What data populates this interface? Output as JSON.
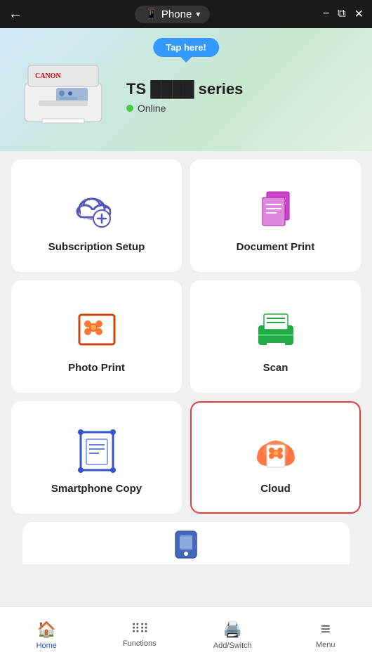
{
  "titleBar": {
    "backLabel": "←",
    "deviceIcon": "📱",
    "title": "Phone",
    "chevron": "▾",
    "minimizeBtn": "−",
    "restoreBtn": "⧉",
    "closeBtn": "✕"
  },
  "hero": {
    "tapBubble": "Tap here!",
    "printerModel": "TS ████ series",
    "statusText": "Online"
  },
  "grid": {
    "items": [
      {
        "id": "subscription-setup",
        "label": "Subscription Setup",
        "selected": false
      },
      {
        "id": "document-print",
        "label": "Document Print",
        "selected": false
      },
      {
        "id": "photo-print",
        "label": "Photo Print",
        "selected": false
      },
      {
        "id": "scan",
        "label": "Scan",
        "selected": false
      },
      {
        "id": "smartphone-copy",
        "label": "Smartphone Copy",
        "selected": false
      },
      {
        "id": "cloud",
        "label": "Cloud",
        "selected": true
      }
    ]
  },
  "bottomNav": {
    "items": [
      {
        "id": "home",
        "label": "Home",
        "icon": "🏠",
        "active": true
      },
      {
        "id": "functions",
        "label": "Functions",
        "icon": "⠿",
        "active": false
      },
      {
        "id": "add-switch",
        "label": "Add/Switch",
        "icon": "🖨",
        "active": false
      },
      {
        "id": "menu",
        "label": "Menu",
        "icon": "≡",
        "active": false
      }
    ]
  }
}
